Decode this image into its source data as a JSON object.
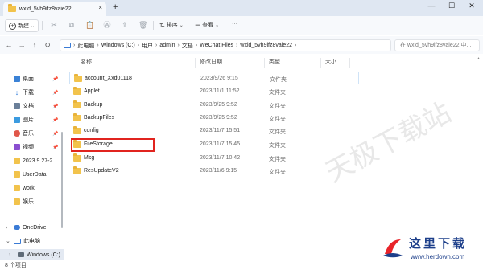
{
  "window": {
    "tab_title": "wxid_5vh9ifz8vaie22",
    "tab_close": "×",
    "new_tab": "+",
    "minimize": "—",
    "maximize": "☐",
    "close": "✕"
  },
  "toolbar": {
    "new_label": "新建",
    "sort_label": "排序",
    "view_label": "查看",
    "more_label": "···"
  },
  "address": {
    "breadcrumbs": [
      "此电脑",
      "Windows (C:)",
      "用户",
      "admin",
      "文档",
      "WeChat Files",
      "wxid_5vh9ifz8vaie22"
    ],
    "search_placeholder": "在 wxid_5vh9ifz8vaie22 中..."
  },
  "sidebar": {
    "items": [
      {
        "label": "桌面",
        "icon": "desktop-icon",
        "pinned": true
      },
      {
        "label": "下载",
        "icon": "download-icon",
        "pinned": true
      },
      {
        "label": "文档",
        "icon": "document-icon",
        "pinned": true
      },
      {
        "label": "图片",
        "icon": "picture-icon",
        "pinned": true
      },
      {
        "label": "音乐",
        "icon": "music-icon",
        "pinned": true
      },
      {
        "label": "视频",
        "icon": "video-icon",
        "pinned": true
      },
      {
        "label": "2023.9.27-2",
        "icon": "folder-icon",
        "pinned": false
      },
      {
        "label": "UserData",
        "icon": "folder-icon",
        "pinned": false
      },
      {
        "label": "work",
        "icon": "folder-icon",
        "pinned": false
      },
      {
        "label": "娱乐",
        "icon": "folder-icon",
        "pinned": false
      },
      {
        "label": "OneDrive",
        "icon": "cloud-icon",
        "pinned": false
      },
      {
        "label": "此电脑",
        "icon": "pc-icon",
        "pinned": false
      },
      {
        "label": "Windows (C:)",
        "icon": "drive-icon",
        "pinned": false
      }
    ]
  },
  "columns": {
    "name": "名称",
    "date": "修改日期",
    "type": "类型",
    "size": "大小"
  },
  "files": [
    {
      "name": "account_Xxd01118",
      "date": "2023/9/26 9:15",
      "type": "文件夹"
    },
    {
      "name": "Applet",
      "date": "2023/11/1 11:52",
      "type": "文件夹"
    },
    {
      "name": "Backup",
      "date": "2023/9/25 9:52",
      "type": "文件夹"
    },
    {
      "name": "BackupFiles",
      "date": "2023/9/25 9:52",
      "type": "文件夹"
    },
    {
      "name": "config",
      "date": "2023/11/7 15:51",
      "type": "文件夹"
    },
    {
      "name": "FileStorage",
      "date": "2023/11/7 15:45",
      "type": "文件夹"
    },
    {
      "name": "Msg",
      "date": "2023/11/7 10:42",
      "type": "文件夹"
    },
    {
      "name": "ResUpdateV2",
      "date": "2023/11/6 9:15",
      "type": "文件夹"
    }
  ],
  "status": {
    "item_count": "8 个项目"
  },
  "watermark": {
    "diagonal_text": "天极下载站",
    "brand": "这里下载",
    "site": "www.herdown.com"
  },
  "colors": {
    "highlight_box": "#e1241f",
    "folder": "#f2c34c",
    "accent": "#3a7bd5"
  }
}
